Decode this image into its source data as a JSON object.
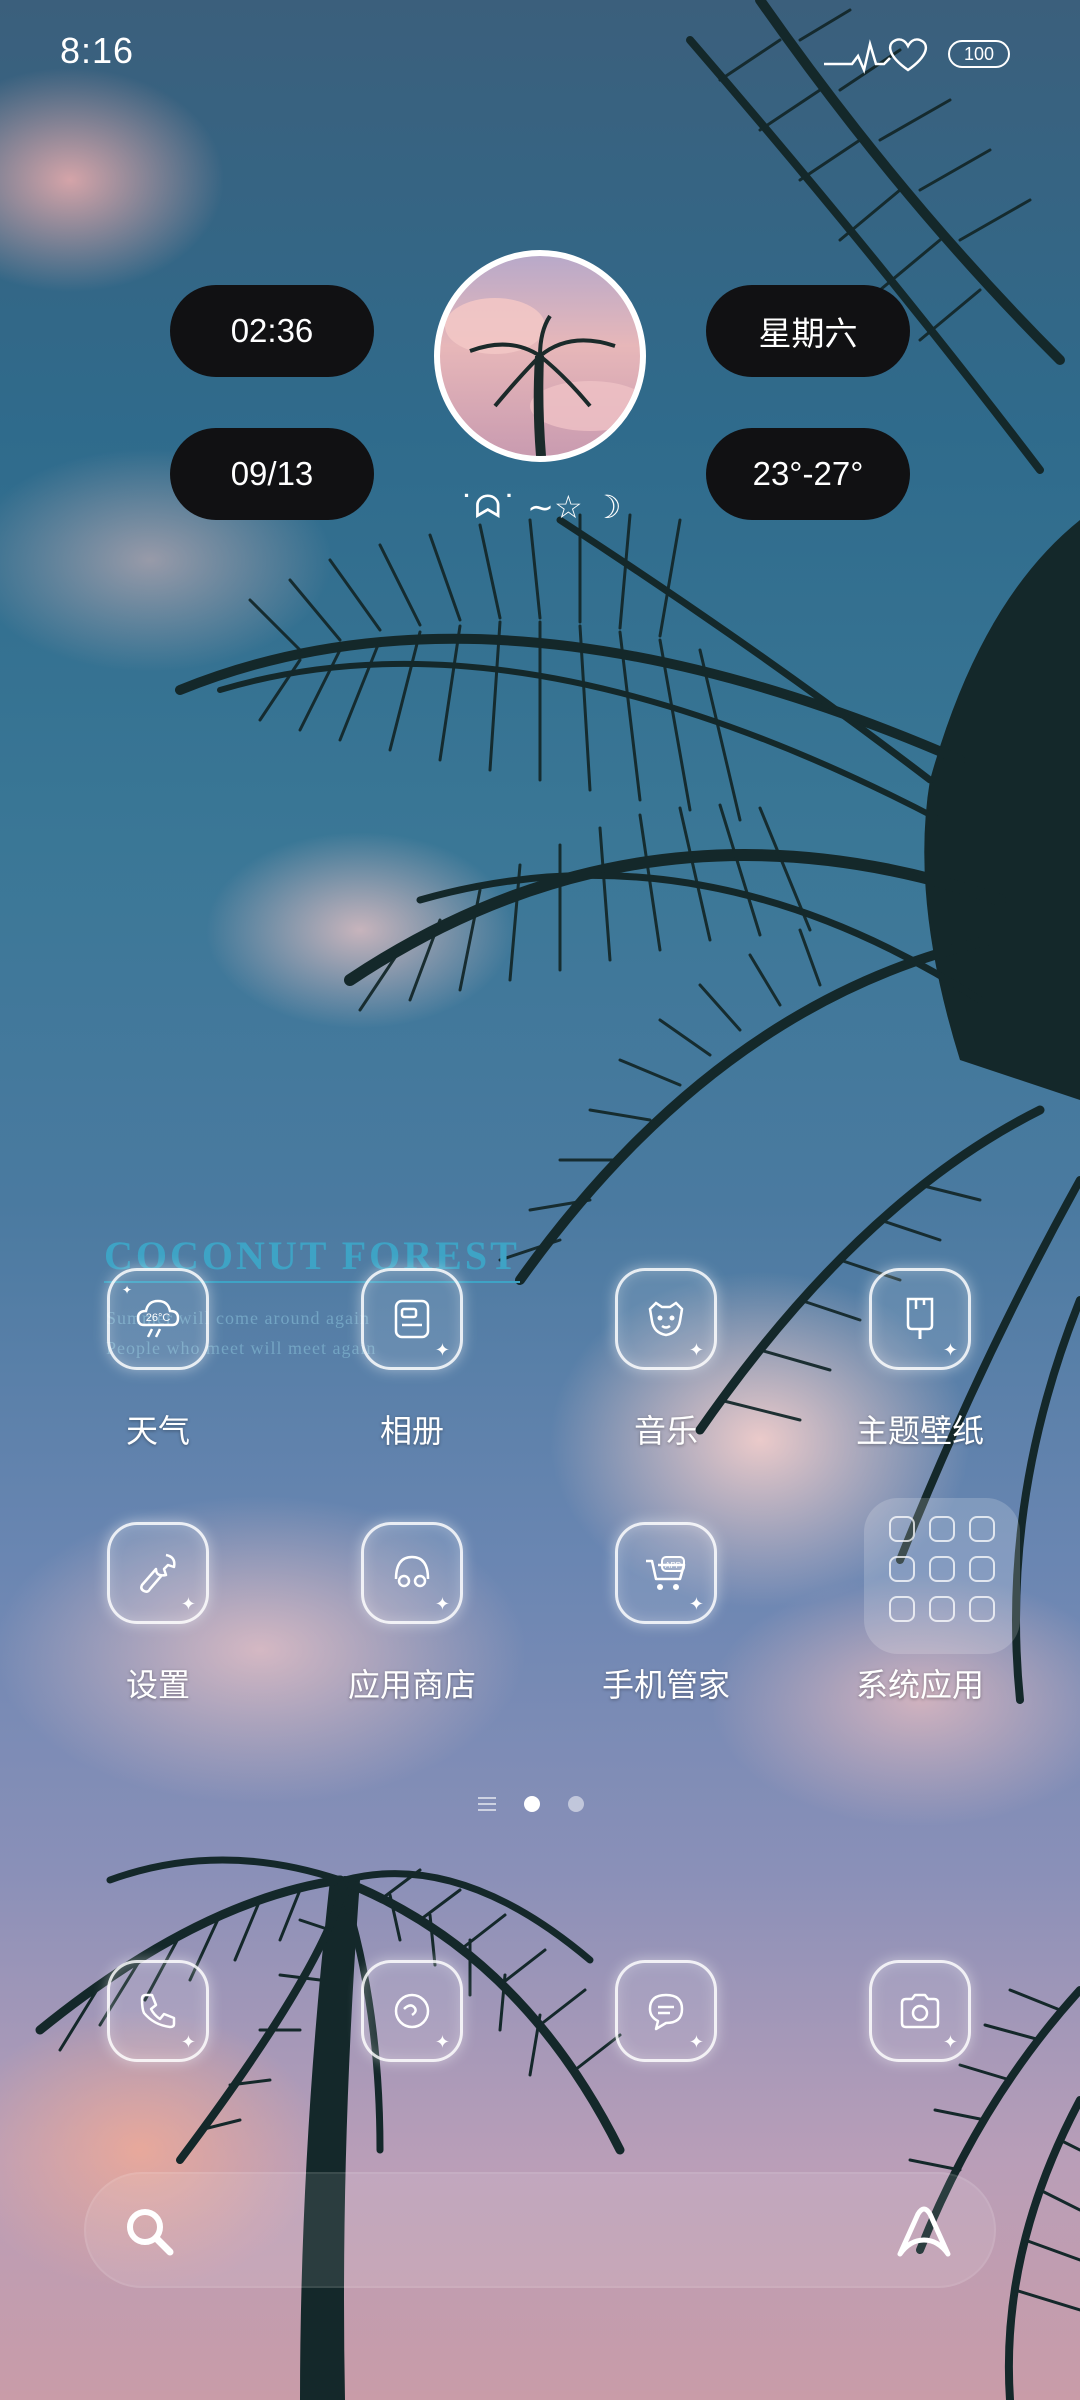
{
  "status_bar": {
    "time": "8:16",
    "battery": "100",
    "icons": [
      "pulse-heart-icon",
      "battery-icon"
    ]
  },
  "widget": {
    "clock": "02:36",
    "date": "09/13",
    "weekday": "星期六",
    "temperature": "23°-27°",
    "decoration": "˙ᗣ˙ ~☆ ☽"
  },
  "wallpaper_text": {
    "title": "COCONUT FOREST",
    "line1": "Summer will come around again",
    "line2": "People who meet will meet again"
  },
  "apps": [
    {
      "label": "天气",
      "icon": "weather-icon",
      "icon_text": "26°C"
    },
    {
      "label": "相册",
      "icon": "gallery-icon"
    },
    {
      "label": "音乐",
      "icon": "music-icon"
    },
    {
      "label": "主题壁纸",
      "icon": "theme-wallpaper-icon"
    },
    {
      "label": "设置",
      "icon": "settings-icon"
    },
    {
      "label": "应用商店",
      "icon": "app-store-icon"
    },
    {
      "label": "手机管家",
      "icon": "phone-manager-icon",
      "icon_text": "APP"
    },
    {
      "label": "系统应用",
      "icon": "system-apps-folder"
    }
  ],
  "dock": [
    {
      "icon": "phone-icon"
    },
    {
      "icon": "browser-icon"
    },
    {
      "icon": "messages-icon"
    },
    {
      "icon": "camera-icon"
    }
  ],
  "page_indicator": {
    "pages": 2,
    "active": 1
  },
  "search": {
    "left_icon": "search-icon",
    "right_icon": "assistant-icon"
  },
  "colors": {
    "pill_bg": "#111113",
    "title_accent": "#3ea3c5",
    "text": "#ffffff"
  }
}
